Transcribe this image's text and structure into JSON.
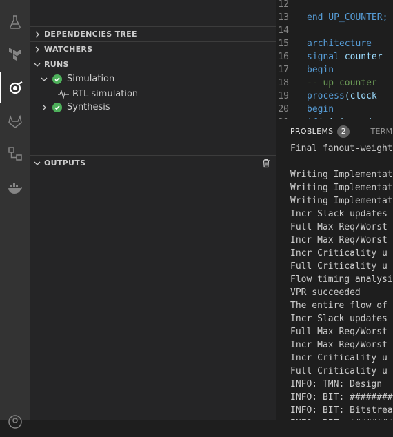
{
  "activity_bar": {
    "icons": [
      "flask-icon",
      "terraform-icon",
      "edaa-icon",
      "gitlab-icon",
      "source-control-icon",
      "docker-icon",
      "account-icon"
    ]
  },
  "sidebar": {
    "sections": {
      "dependencies": "DEPENDENCIES TREE",
      "watchers": "WATCHERS",
      "runs": "RUNS",
      "outputs": "OUTPUTS"
    },
    "runs": [
      {
        "label": "Simulation",
        "status": "success",
        "expanded": true,
        "children": [
          {
            "label": "RTL simulation"
          }
        ]
      },
      {
        "label": "Synthesis",
        "status": "success",
        "expanded": false
      }
    ]
  },
  "editor": {
    "lines": [
      {
        "n": "12",
        "text": ""
      },
      {
        "n": "13",
        "text": "end UP_COUNTER;"
      },
      {
        "n": "14",
        "text": ""
      },
      {
        "n": "15",
        "text": "architecture"
      },
      {
        "n": "16",
        "text": "signal counter"
      },
      {
        "n": "17",
        "text": "begin"
      },
      {
        "n": "18",
        "text": "-- up counter"
      },
      {
        "n": "19",
        "text": "process(clock"
      },
      {
        "n": "20",
        "text": "begin"
      },
      {
        "n": "21",
        "text": "if(rising_edge"
      }
    ]
  },
  "panel": {
    "tabs": [
      {
        "label": "PROBLEMS",
        "badge": "2"
      },
      {
        "label": "TERMINAL"
      }
    ],
    "terminal_lines": [
      "Final fanout-weighted",
      "",
      "Writing Implementation",
      "Writing Implementation",
      "Writing Implementation",
      "Incr Slack updates",
      "Full Max Req/Worst",
      "Incr Max Req/Worst",
      "Incr Criticality u",
      "Full Criticality u",
      "Flow timing analysis",
      "VPR succeeded",
      "The entire flow of",
      "Incr Slack updates",
      "Full Max Req/Worst",
      "Incr Max Req/Worst",
      "Incr Criticality u",
      "Full Criticality u",
      "INFO: TMN: Design",
      "INFO: BIT: ########",
      "INFO: BIT: Bitstream",
      "INFO: BIT: ########"
    ]
  },
  "colors": {
    "keyword": "#569cd6",
    "comment": "#6a9955",
    "function": "#dcdcaa",
    "identifier": "#9cdcfe",
    "success": "#4eb05b"
  }
}
